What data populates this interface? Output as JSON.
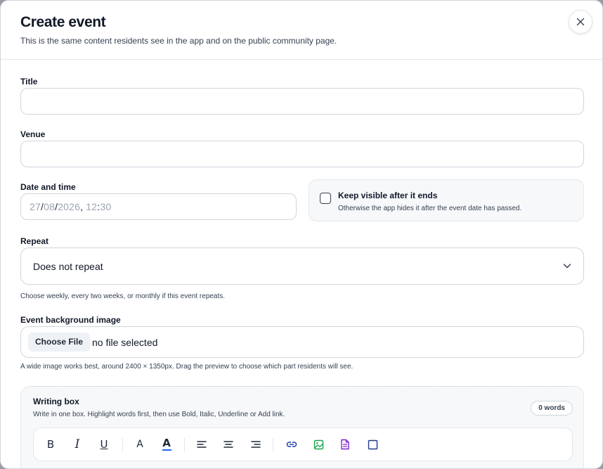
{
  "header": {
    "title": "Create event",
    "subtitle": "This is the same content residents see in the app and on the public community page."
  },
  "form": {
    "title_label": "Title",
    "title_value": "",
    "venue_label": "Venue",
    "venue_value": "",
    "datetime_label": "Date and time",
    "date": {
      "day": "27",
      "month": "08",
      "year": "2026",
      "hour": "12",
      "minute": "30"
    },
    "keep_visible": {
      "checked": false,
      "label": "Keep visible after it ends",
      "description": "Otherwise the app hides it after the event date has passed."
    },
    "repeat_label": "Repeat",
    "repeat_value": "Does not repeat",
    "repeat_help": "Choose weekly, every two weeks, or monthly if this event repeats.",
    "image_label": "Event background image",
    "file_button": "Choose File",
    "file_status": "no file selected",
    "image_help": "A wide image works best, around 2400 × 1350px. Drag the preview to choose which part residents will see."
  },
  "writing_box": {
    "title": "Writing box",
    "subtitle": "Write in one box. Highlight words first, then use Bold, Italic, Underline or Add link.",
    "word_count": "0 words"
  },
  "toolbar": {
    "bold": "B",
    "italic": "I",
    "underline": "U",
    "font_size": "A",
    "text_color": "A"
  },
  "colors": {
    "accent": "#2563eb",
    "image_icon": "#16a34a",
    "doc_icon": "#7e22ce"
  },
  "icons": [
    "close-icon",
    "chevron-down-icon",
    "align-left-icon",
    "align-center-icon",
    "align-right-icon",
    "link-icon",
    "image-icon",
    "document-icon",
    "box-icon"
  ]
}
